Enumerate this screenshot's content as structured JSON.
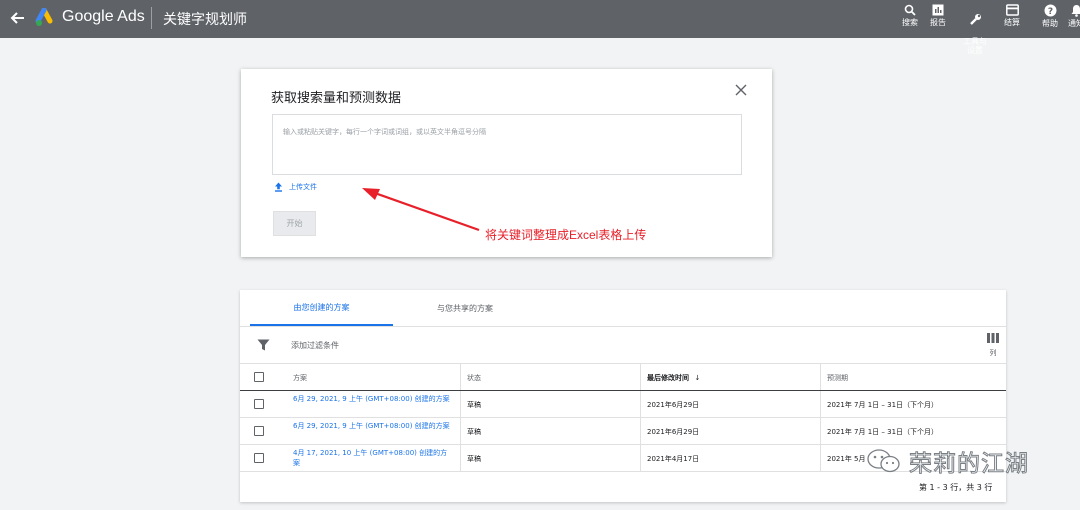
{
  "header": {
    "brand": "Google Ads",
    "tool_title": "关键字规划师",
    "items": [
      {
        "label": "搜索",
        "icon": "search-icon"
      },
      {
        "label": "报告",
        "icon": "report-icon"
      },
      {
        "label": "工具与\n设置",
        "icon": "wrench-icon"
      },
      {
        "label": "结算",
        "icon": "billing-icon"
      },
      {
        "label": "帮助",
        "icon": "help-icon"
      },
      {
        "label": "通知",
        "icon": "bell-icon"
      }
    ]
  },
  "dialog": {
    "title": "获取搜索量和预测数据",
    "placeholder": "输入或粘贴关键字，每行一个字词或词组，或以英文半角逗号分隔",
    "upload_label": "上传文件",
    "start_label": "开始"
  },
  "annotation": {
    "text": "将关键词整理成Excel表格上传",
    "color": "#e8202a"
  },
  "plans": {
    "tabs": [
      "由您创建的方案",
      "与您共享的方案"
    ],
    "active_tab": 0,
    "filter_label": "添加过滤条件",
    "columns_label": "列",
    "headers": [
      "方案",
      "状态",
      "最后修改时间",
      "预测期"
    ],
    "rows": [
      {
        "plan": "6月 29, 2021, 9 上午 (GMT+08:00) 创建的方案",
        "status": "草稿",
        "modified": "2021年6月29日",
        "period": "2021年 7月 1日 – 31日（下个月）"
      },
      {
        "plan": "6月 29, 2021, 9 上午 (GMT+08:00) 创建的方案",
        "status": "草稿",
        "modified": "2021年6月29日",
        "period": "2021年 7月 1日 – 31日（下个月）"
      },
      {
        "plan": "4月 17, 2021, 10 上午 (GMT+08:00) 创建的方案",
        "status": "草稿",
        "modified": "2021年4月17日",
        "period": "2021年 5月"
      }
    ],
    "pager": "第 1 - 3 行，共 3 行"
  },
  "watermark": {
    "text": "荣莉的江湖"
  },
  "colors": {
    "topbar": "#5f6368",
    "accent": "#1a73e8",
    "background": "#f1f3f4"
  }
}
